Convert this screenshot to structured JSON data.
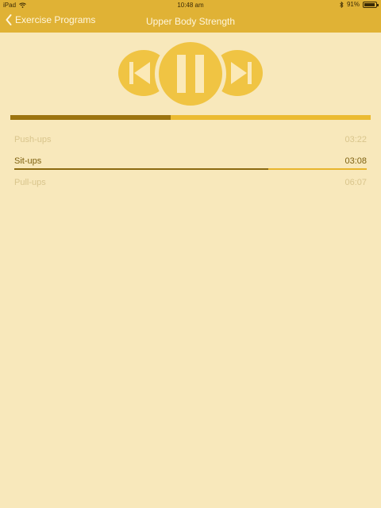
{
  "status_bar": {
    "device": "iPad",
    "time": "10:48 am",
    "battery_text": "91%",
    "battery_level": 0.91
  },
  "nav": {
    "back_label": "Exercise Programs",
    "title": "Upper Body Strength"
  },
  "player": {
    "overall_progress": 0.445
  },
  "tracks": [
    {
      "name": "Push-ups",
      "duration": "03:22",
      "state": "inactive"
    },
    {
      "name": "Sit-ups",
      "duration": "03:08",
      "state": "active",
      "progress": 0.72
    },
    {
      "name": "Pull-ups",
      "duration": "06:07",
      "state": "inactive"
    }
  ],
  "icons": {
    "wifi": "wifi-icon",
    "bluetooth": "bluetooth-icon",
    "battery": "battery-icon",
    "back": "chevron-left-icon",
    "previous": "skip-previous-icon",
    "pause": "pause-icon",
    "next": "skip-next-icon"
  },
  "colors": {
    "bar": "#e0b235",
    "background": "#f8e8bb",
    "accent": "#f0c443",
    "progress_done": "#9c7410",
    "text_active": "#7e6110",
    "text_inactive": "#d9c58c"
  }
}
